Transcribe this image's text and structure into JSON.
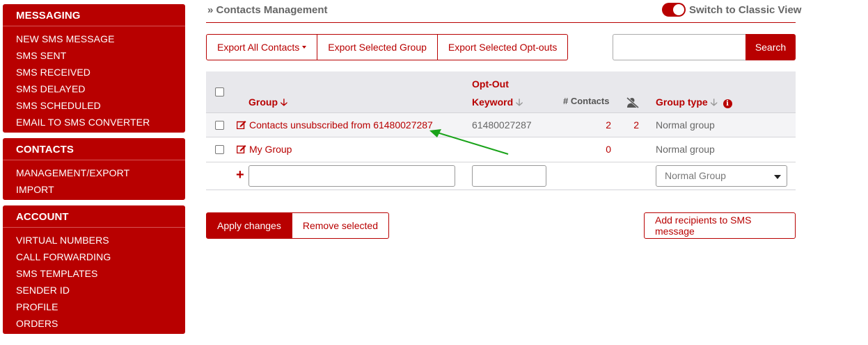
{
  "sidebar": {
    "messaging": {
      "title": "MESSAGING",
      "items": [
        "NEW SMS MESSAGE",
        "SMS SENT",
        "SMS RECEIVED",
        "SMS DELAYED",
        "SMS SCHEDULED",
        "EMAIL TO SMS CONVERTER"
      ]
    },
    "contacts": {
      "title": "CONTACTS",
      "items": [
        "MANAGEMENT/EXPORT",
        "IMPORT"
      ]
    },
    "account": {
      "title": "ACCOUNT",
      "items": [
        "VIRTUAL NUMBERS",
        "CALL FORWARDING",
        "SMS TEMPLATES",
        "SENDER ID",
        "PROFILE",
        "ORDERS"
      ]
    }
  },
  "header": {
    "breadcrumb_prefix": "»",
    "breadcrumb": "Contacts Management",
    "classic_view_label": "Switch to Classic View",
    "classic_view_on": true
  },
  "toolbar": {
    "export_all": "Export All Contacts",
    "export_group": "Export Selected Group",
    "export_optouts": "Export Selected Opt-outs",
    "search_value": "",
    "search_button": "Search"
  },
  "table": {
    "headers": {
      "group": "Group",
      "optout_line1": "Opt-Out",
      "optout_line2": "Keyword",
      "contacts": "# Contacts",
      "optout_icon": "person-slash-icon",
      "group_type": "Group type",
      "info_icon": "i"
    },
    "rows": [
      {
        "name": "Contacts unsubscribed from 61480027287",
        "keyword": "61480027287",
        "contacts": "2",
        "optouts": "2",
        "type": "Normal group"
      },
      {
        "name": "My Group",
        "keyword": "",
        "contacts": "0",
        "optouts": "",
        "type": "Normal group"
      }
    ],
    "new_row": {
      "add_symbol": "+",
      "group_name_value": "",
      "keyword_value": "",
      "type_selected": "Normal Group"
    }
  },
  "actions": {
    "apply": "Apply changes",
    "remove": "Remove selected",
    "add_recipients": "Add recipients to SMS message"
  },
  "colors": {
    "brand": "#b80000",
    "annotation_arrow": "#1aa31a"
  }
}
